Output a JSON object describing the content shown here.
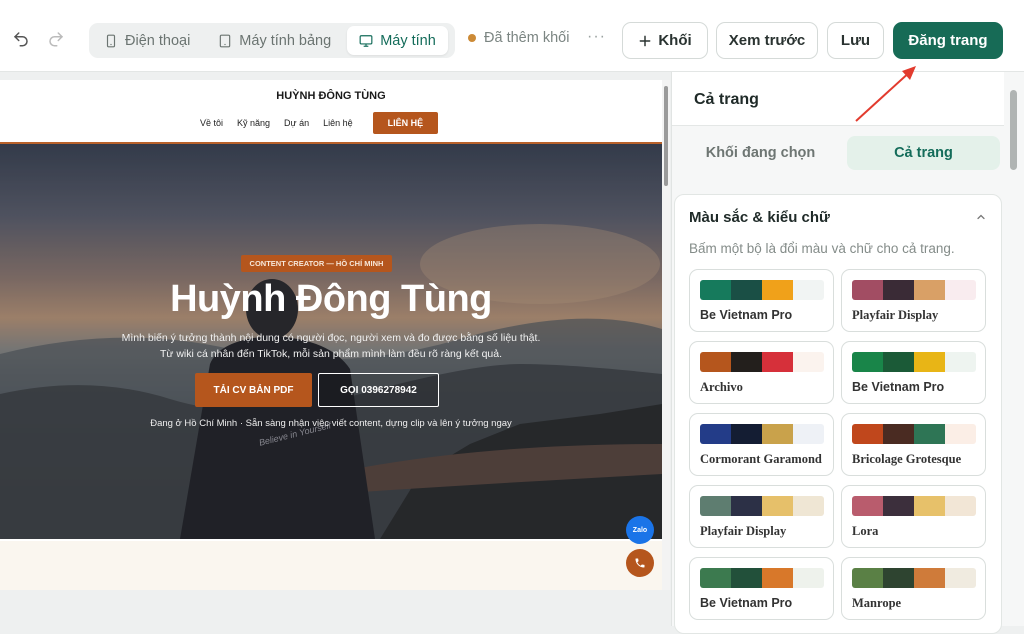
{
  "toolbar": {
    "undo_icon": "undo-icon",
    "redo_icon": "redo-icon",
    "devices": [
      {
        "label": "Điện thoại",
        "icon": "phone-icon"
      },
      {
        "label": "Máy tính bảng",
        "icon": "tablet-icon"
      },
      {
        "label": "Máy tính",
        "icon": "desktop-icon"
      }
    ],
    "active_device": "Máy tính",
    "status": "Đã thêm khối",
    "more": "···",
    "add_block": "Khối",
    "preview": "Xem trước",
    "save": "Lưu",
    "publish": "Đăng trang"
  },
  "site": {
    "name": "HUỲNH ĐÔNG TÙNG",
    "nav": [
      "Về tôi",
      "Kỹ năng",
      "Dự án",
      "Liên hệ"
    ],
    "nav_cta": "LIÊN HỆ",
    "badge": "CONTENT CREATOR — HỒ CHÍ MINH",
    "title": "Huỳnh Đông Tùng",
    "desc_line1": "Mình biến ý tưởng thành nội dung có người đọc, người xem và đo được bằng số liệu thật.",
    "desc_line2": "Từ wiki cá nhân đến TikTok, mỗi sản phẩm mình làm đều rõ ràng kết quả.",
    "btn_cv": "TẢI CV BẢN PDF",
    "btn_call": "GỌI 0396278942",
    "note": "Đang ở Hồ Chí Minh · Sẵn sàng nhận việc viết content, dựng clip và lên ý tưởng ngay",
    "shirt_text": "Believe in Yourself",
    "zalo": "Zalo"
  },
  "panel": {
    "title": "Cả trang",
    "tabs": [
      "Khối đang chọn",
      "Cả trang"
    ],
    "active_tab": "Cả trang",
    "section_title": "Màu sắc & kiểu chữ",
    "section_sub": "Bấm một bộ là đổi màu và chữ cho cả trang.",
    "themes": [
      {
        "name": "Be Vietnam Pro",
        "colors": [
          "#167a5c",
          "#1a4f45",
          "#f0a11a",
          "#f1f4f3"
        ]
      },
      {
        "name": "Playfair Display",
        "colors": [
          "#a24d63",
          "#3a2b36",
          "#d9a066",
          "#f9ecef"
        ]
      },
      {
        "name": "Archivo",
        "colors": [
          "#b5561d",
          "#231f1c",
          "#d6303a",
          "#fbf3ee"
        ]
      },
      {
        "name": "Be Vietnam Pro",
        "colors": [
          "#198549",
          "#1b5a37",
          "#e8b516",
          "#eef4f0"
        ]
      },
      {
        "name": "Cormorant Garamond",
        "colors": [
          "#233c88",
          "#141d33",
          "#c9a24b",
          "#eef1f6"
        ]
      },
      {
        "name": "Bricolage Grotesque",
        "colors": [
          "#c0471c",
          "#4a2b22",
          "#2e7555",
          "#fbeee6"
        ]
      },
      {
        "name": "Playfair Display",
        "colors": [
          "#5e7d70",
          "#2c3046",
          "#e6c06a",
          "#efe6d4"
        ]
      },
      {
        "name": "Lora",
        "colors": [
          "#b95c6d",
          "#3c2f3c",
          "#e7c16a",
          "#f2e6d6"
        ]
      },
      {
        "name": "Be Vietnam Pro",
        "colors": [
          "#3c7a4f",
          "#22503a",
          "#d8782a",
          "#eef2ec"
        ]
      },
      {
        "name": "Manrope",
        "colors": [
          "#5a8045",
          "#2e4430",
          "#cf7b3a",
          "#f0ebe0"
        ]
      }
    ]
  }
}
